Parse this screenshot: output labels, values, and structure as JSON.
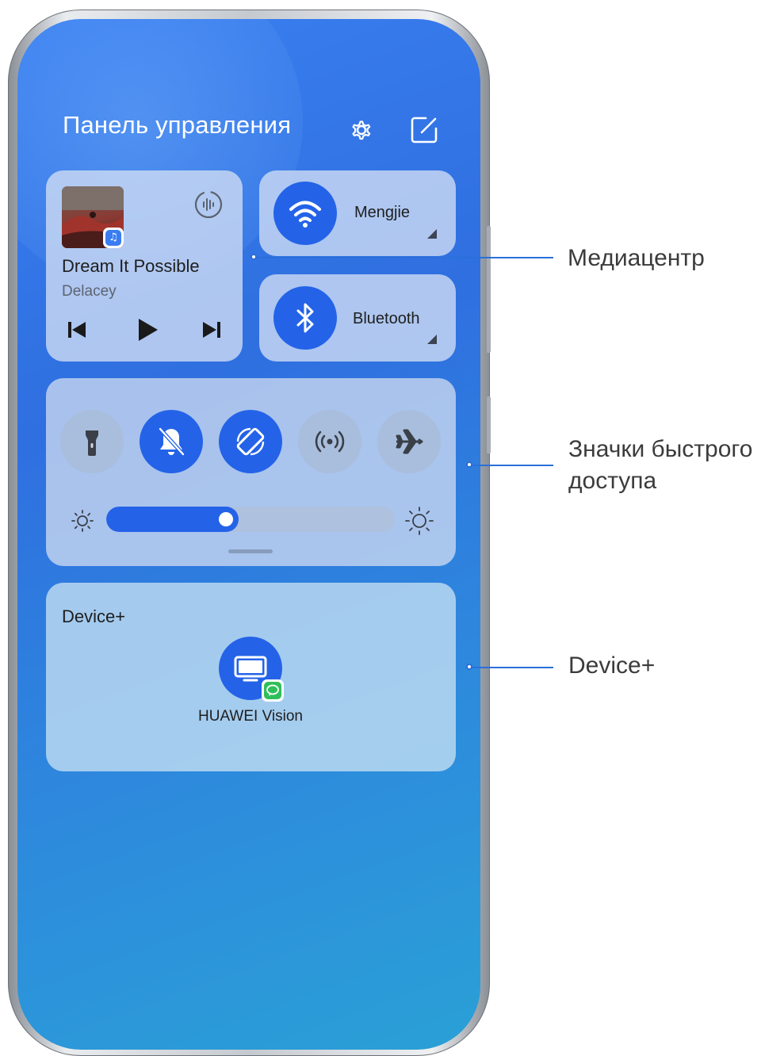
{
  "control_panel": {
    "title": "Панель управления",
    "settings_icon": "gear-icon",
    "edit_icon": "edit-icon"
  },
  "media": {
    "song_title": "Dream It Possible",
    "artist": "Delacey",
    "album_badge_icon": "music-app-icon",
    "cast_icon": "audio-output-icon",
    "prev_icon": "skip-previous-icon",
    "play_icon": "play-icon",
    "next_icon": "skip-next-icon"
  },
  "wifi": {
    "label": "Mengjie",
    "icon": "wifi-icon",
    "state": "on"
  },
  "bluetooth": {
    "label": "Bluetooth",
    "icon": "bluetooth-icon",
    "state": "on"
  },
  "quick_toggles": [
    {
      "name": "flashlight",
      "icon": "flashlight-icon",
      "state": "off"
    },
    {
      "name": "silent",
      "icon": "bell-off-icon",
      "state": "on"
    },
    {
      "name": "auto-rotate",
      "icon": "rotate-icon",
      "state": "on"
    },
    {
      "name": "hotspot",
      "icon": "hotspot-icon",
      "state": "off"
    },
    {
      "name": "airplane",
      "icon": "airplane-icon",
      "state": "off"
    }
  ],
  "brightness": {
    "level": 0.46,
    "low_icon": "brightness-low-icon",
    "high_icon": "brightness-high-icon"
  },
  "device_plus": {
    "title": "Device+",
    "device_label": "HUAWEI Vision",
    "device_icon": "tv-icon",
    "badge_icon": "chat-badge-icon"
  },
  "callouts": {
    "media": "Медиацентр",
    "quick_line1": "Значки быстрого",
    "quick_line2": "доступа",
    "device": "Device+"
  },
  "colors": {
    "accent": "#2463e8",
    "callout_line": "#2b6fd9"
  }
}
